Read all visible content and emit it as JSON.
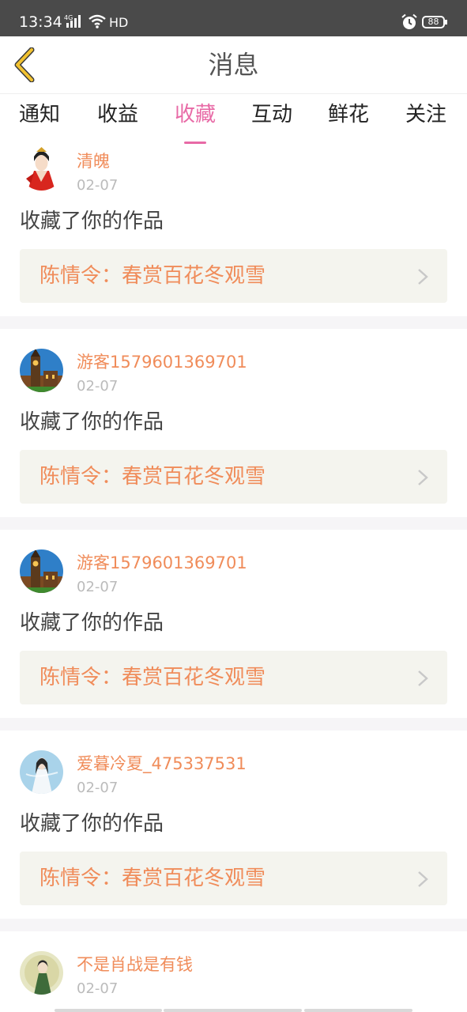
{
  "status_bar": {
    "time": "13:34",
    "network_label": "4G",
    "hd_label": "HD",
    "battery": "88",
    "icons": [
      "signal-icon",
      "wifi-icon",
      "alarm-icon",
      "battery-icon"
    ]
  },
  "header": {
    "title": "消息",
    "back_icon": "back-chevron-icon"
  },
  "tabs": [
    {
      "label": "通知",
      "active": false
    },
    {
      "label": "收益",
      "active": false
    },
    {
      "label": "收藏",
      "active": true
    },
    {
      "label": "互动",
      "active": false
    },
    {
      "label": "鲜花",
      "active": false
    },
    {
      "label": "关注",
      "active": false
    }
  ],
  "feed": [
    {
      "username": "清魄",
      "date": "02-07",
      "action": "收藏了你的作品",
      "work_title": "陈情令：春赏百花冬观雪",
      "avatar": "costume-woman-avatar"
    },
    {
      "username": "游客1579601369701",
      "date": "02-07",
      "action": "收藏了你的作品",
      "work_title": "陈情令：春赏百花冬观雪",
      "avatar": "clock-tower-avatar"
    },
    {
      "username": "游客1579601369701",
      "date": "02-07",
      "action": "收藏了你的作品",
      "work_title": "陈情令：春赏百花冬观雪",
      "avatar": "clock-tower-avatar"
    },
    {
      "username": "爱暮冷夏_475337531",
      "date": "02-07",
      "action": "收藏了你的作品",
      "work_title": "陈情令：春赏百花冬观雪",
      "avatar": "white-robe-avatar"
    },
    {
      "username": "不是肖战是有钱",
      "date": "02-07",
      "action": "",
      "work_title": "",
      "avatar": "figure-avatar"
    }
  ],
  "colors": {
    "accent": "#e86aa6",
    "username": "#f08c5a",
    "work_bg": "#f4f4ee",
    "back_icon": "#f2c230",
    "status_bar": "#4a4a4a"
  }
}
